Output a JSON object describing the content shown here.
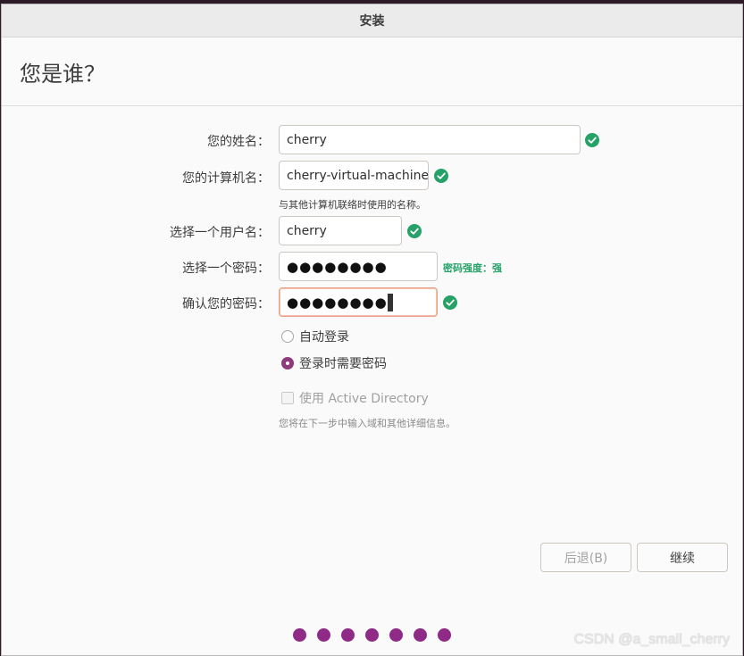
{
  "window": {
    "title": "安装"
  },
  "page": {
    "heading": "您是谁？"
  },
  "form": {
    "name": {
      "label": "您的姓名：",
      "value": "cherry"
    },
    "computer": {
      "label": "您的计算机名：",
      "value": "cherry-virtual-machine",
      "hint": "与其他计算机联络时使用的名称。"
    },
    "username": {
      "label": "选择一个用户名：",
      "value": "cherry"
    },
    "password": {
      "label": "选择一个密码：",
      "value": "●●●●●●●●",
      "strength": "密码强度：强"
    },
    "confirm": {
      "label": "确认您的密码：",
      "value": "●●●●●●●●"
    }
  },
  "login_options": {
    "auto_login": "自动登录",
    "require_password": "登录时需要密码",
    "selected": "require_password"
  },
  "active_directory": {
    "label": "使用 Active Directory",
    "note": "您将在下一步中输入域和其他详细信息。",
    "checked": false
  },
  "buttons": {
    "back": "后退(B)",
    "next": "继续"
  },
  "progress": {
    "total_steps": 7
  },
  "watermark": "CSDN @a_small_cherry",
  "colors": {
    "accent": "#8f2b86",
    "valid": "#26a269",
    "focus_border": "#e9a087"
  }
}
